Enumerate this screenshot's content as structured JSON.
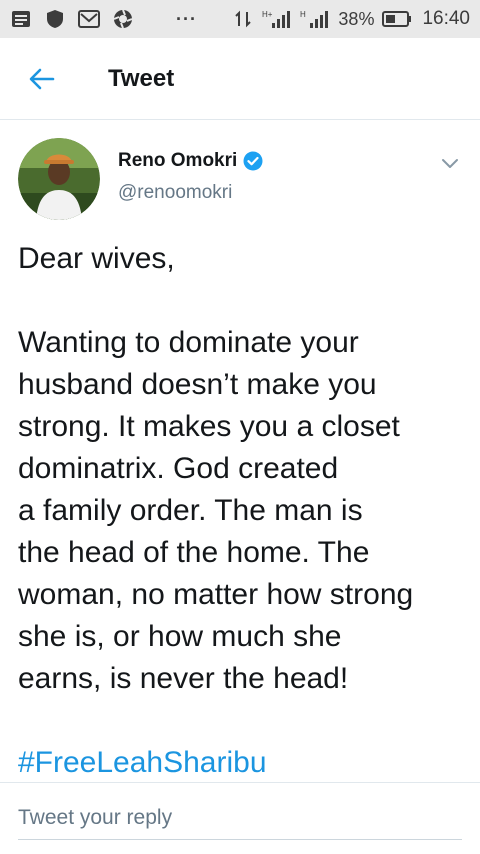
{
  "status_bar": {
    "icons": [
      "notes-icon",
      "shield-icon",
      "mail-icon",
      "aperture-icon"
    ],
    "overflow": "···",
    "network_label_1": "H+",
    "network_label_2": "H",
    "battery_percent": "38%",
    "time": "16:40"
  },
  "header": {
    "back_icon": "arrow-left-icon",
    "title": "Tweet"
  },
  "tweet": {
    "author_name": "Reno Omokri",
    "verified": true,
    "handle": "@renoomokri",
    "menu_icon": "chevron-down-icon",
    "greeting": "Dear wives,",
    "body_lines": [
      "Wanting to dominate your",
      "husband doesn’t make you",
      "strong. It makes you a closet",
      "dominatrix. God created",
      "a family order. The man is",
      "the head of the home. The",
      "woman, no matter how strong",
      "she is, or how much she",
      "earns, is never the head!"
    ],
    "hashtag": "#FreeLeahSharibu"
  },
  "reply": {
    "placeholder": "Tweet your reply"
  },
  "colors": {
    "accent": "#1b95e0",
    "verified_badge": "#1da1f2",
    "status_bar_bg": "#e9e9e9",
    "secondary_text": "#657786"
  }
}
